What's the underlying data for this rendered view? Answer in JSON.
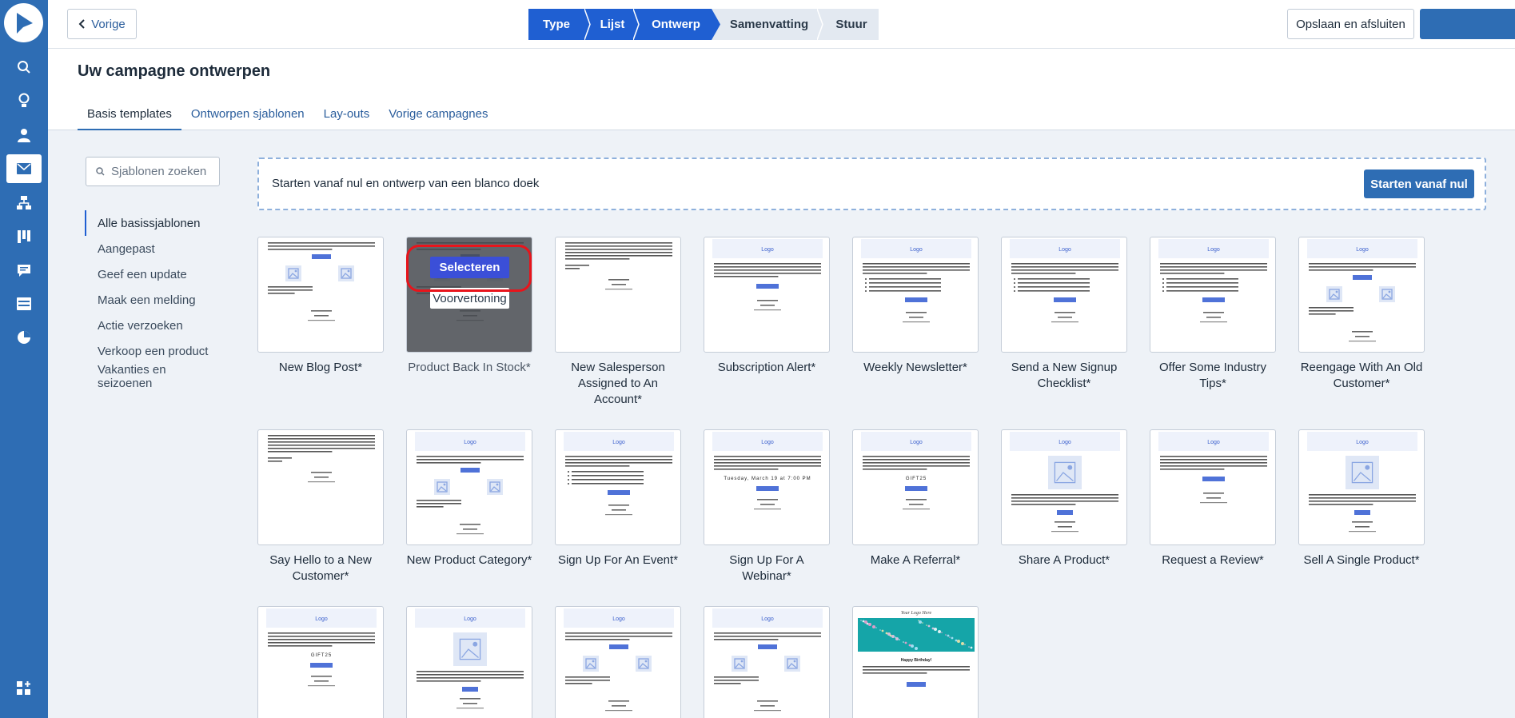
{
  "topbar": {
    "back_label": "Vorige",
    "steps": [
      "Type",
      "Lijst",
      "Ontwerp",
      "Samenvatting",
      "Stuur"
    ],
    "current_step": "Ontwerp",
    "save_label": "Opslaan en afsluiten"
  },
  "header": {
    "title": "Uw campagne ontwerpen",
    "tabs": [
      "Basis templates",
      "Ontworpen sjablonen",
      "Lay-outs",
      "Vorige campagnes"
    ],
    "active_tab": "Basis templates"
  },
  "sidebar": {
    "search_placeholder": "Sjablonen zoeken",
    "categories": [
      "Alle basissjablonen",
      "Aangepast",
      "Geef een update",
      "Maak een melding",
      "Actie verzoeken",
      "Verkoop een product",
      "Vakanties en seizoenen"
    ],
    "active_category": "Alle basissjablonen"
  },
  "blank_start": {
    "text": "Starten vanaf nul en ontwerp van een blanco doek",
    "button": "Starten vanaf nul"
  },
  "hover_card": {
    "select_label": "Selecteren",
    "preview_label": "Voorvertoning"
  },
  "templates": [
    {
      "name": "New Blog Post*",
      "kind": "two-col",
      "logo": false
    },
    {
      "name": "Product Back In Stock*",
      "kind": "two-col",
      "logo": false,
      "hovered": true
    },
    {
      "name": "New Salesperson Assigned to An Account*",
      "kind": "text",
      "logo": false
    },
    {
      "name": "Subscription Alert*",
      "kind": "button",
      "logo": true
    },
    {
      "name": "Weekly Newsletter*",
      "kind": "list",
      "logo": true
    },
    {
      "name": "Send a New Signup Checklist*",
      "kind": "list",
      "logo": true
    },
    {
      "name": "Offer Some Industry Tips*",
      "kind": "list",
      "logo": true
    },
    {
      "name": "Reengage With An Old Customer*",
      "kind": "two-col",
      "logo": true
    },
    {
      "name": "Say Hello to a New Customer*",
      "kind": "text",
      "logo": false
    },
    {
      "name": "New Product Category*",
      "kind": "two-col",
      "logo": true
    },
    {
      "name": "Sign Up For An Event*",
      "kind": "list",
      "logo": true
    },
    {
      "name": "Sign Up For A Webinar*",
      "kind": "event",
      "logo": true,
      "highlight": "Tuesday, March 19 at 7:00 PM"
    },
    {
      "name": "Make A Referral*",
      "kind": "event",
      "logo": true,
      "highlight": "GIFT25"
    },
    {
      "name": "Share A Product*",
      "kind": "image",
      "logo": true
    },
    {
      "name": "Request a Review*",
      "kind": "button",
      "logo": true
    },
    {
      "name": "Sell A Single Product*",
      "kind": "image",
      "logo": true
    },
    {
      "name": "",
      "kind": "event",
      "logo": true,
      "highlight": "GIFT25"
    },
    {
      "name": "",
      "kind": "image",
      "logo": true
    },
    {
      "name": "",
      "kind": "two-col",
      "logo": true
    },
    {
      "name": "",
      "kind": "two-col",
      "logo": true
    },
    {
      "name": "",
      "kind": "photo",
      "logo": false,
      "header_text": "Your Logo Here",
      "subtitle": "Happy Birthday!"
    }
  ],
  "thumb_logo_text": "Logo",
  "colors": {
    "rail": "#2e6db4",
    "accent": "#1f5fd2",
    "select": "#3b4fd8",
    "highlight_ring": "#e8141b"
  },
  "icons": {
    "rail": [
      "search-icon",
      "lightbulb-icon",
      "contacts-icon",
      "email-icon",
      "sitemap-icon",
      "boards-icon",
      "chat-icon",
      "forms-icon",
      "reports-icon",
      "apps-icon"
    ]
  }
}
